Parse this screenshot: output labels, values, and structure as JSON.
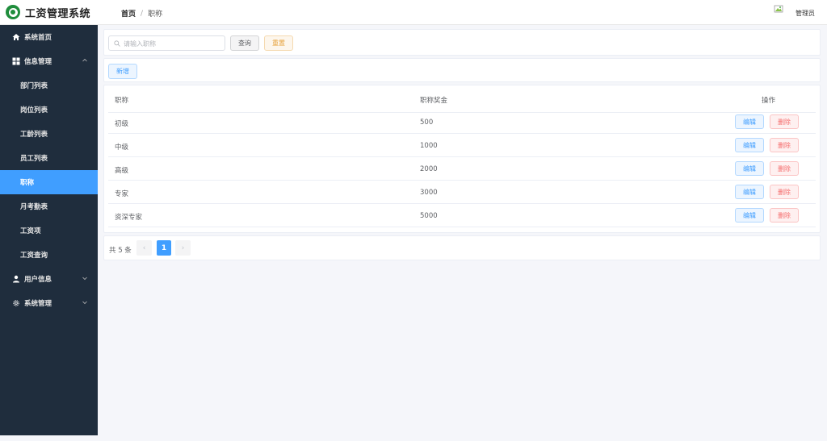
{
  "app": {
    "title": "工资管理系统"
  },
  "breadcrumb": {
    "home": "首页",
    "separator": "/",
    "current": "职称"
  },
  "user": {
    "name": "管理员"
  },
  "sidebar": {
    "items": [
      {
        "label": "系统首页",
        "icon": "home-icon"
      },
      {
        "label": "信息管理",
        "icon": "grid-icon"
      },
      {
        "label": "部门列表"
      },
      {
        "label": "岗位列表"
      },
      {
        "label": "工龄列表"
      },
      {
        "label": "员工列表"
      },
      {
        "label": "职称",
        "active": true
      },
      {
        "label": "月考勤表"
      },
      {
        "label": "工资项"
      },
      {
        "label": "工资查询"
      },
      {
        "label": "用户信息",
        "icon": "user-icon"
      },
      {
        "label": "系统管理",
        "icon": "gear-icon"
      }
    ]
  },
  "search": {
    "placeholder": "请输入职称",
    "query_label": "查询",
    "reset_label": "重置"
  },
  "toolbar": {
    "add_label": "新增"
  },
  "table": {
    "columns": [
      "职称",
      "职称奖金",
      "操作"
    ],
    "rows": [
      {
        "title": "初级",
        "bonus": "500"
      },
      {
        "title": "中级",
        "bonus": "1000"
      },
      {
        "title": "高级",
        "bonus": "2000"
      },
      {
        "title": "专家",
        "bonus": "3000"
      },
      {
        "title": "资深专家",
        "bonus": "5000"
      }
    ],
    "edit_label": "编辑",
    "delete_label": "删除"
  },
  "pagination": {
    "total_text": "共 5 条",
    "current_page": "1",
    "prev": "‹",
    "next": "›"
  },
  "colors": {
    "accent": "#409eff",
    "sidebar_bg": "#1f2d3d",
    "danger": "#f56c6c",
    "warning": "#e6a23c",
    "logo_green": "#1f8d3c"
  }
}
